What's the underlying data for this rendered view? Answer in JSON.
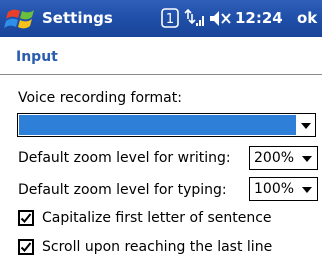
{
  "titlebar": {
    "title": "Settings",
    "clock": "12:24",
    "ok_label": "ok",
    "icons": [
      "windows-start-flag",
      "notification-1",
      "connectivity",
      "volume-muted"
    ],
    "notification_count": "1"
  },
  "page": {
    "section_title": "Input",
    "accent_color": "#2a5db0"
  },
  "form": {
    "voice_label": "Voice recording format:",
    "voice_value": "",
    "writing_zoom_label": "Default zoom level for writing:",
    "writing_zoom_value": "200%",
    "typing_zoom_label": "Default zoom level for typing:",
    "typing_zoom_value": "100%",
    "capitalize_label": "Capitalize first letter of sentence",
    "capitalize_checked": true,
    "scroll_label": "Scroll upon reaching the last line",
    "scroll_checked": true
  }
}
